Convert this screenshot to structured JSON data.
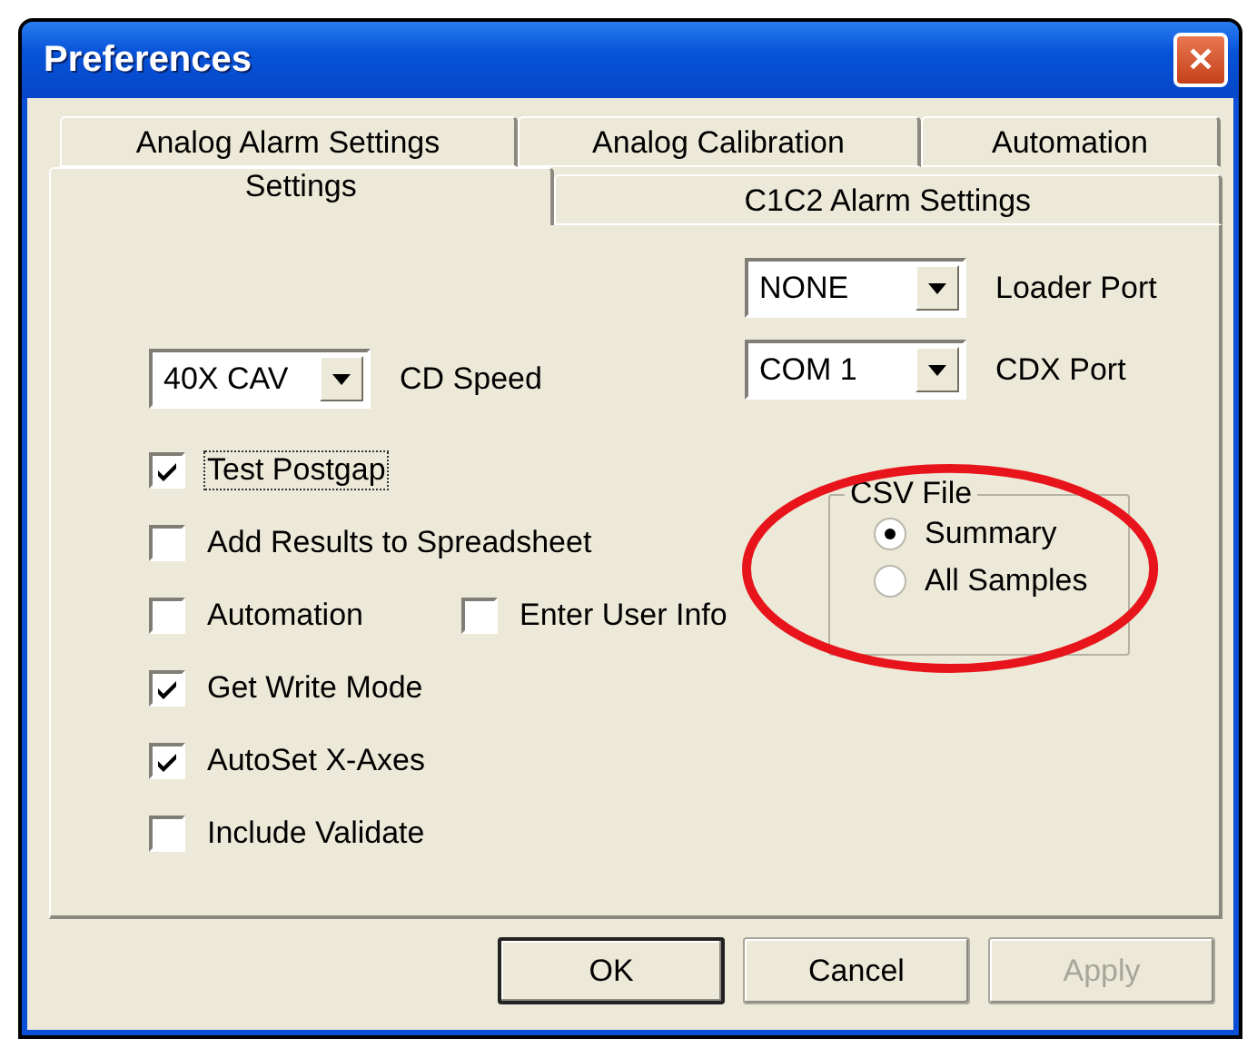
{
  "window": {
    "title": "Preferences",
    "close": "✕"
  },
  "tab_rows": [
    [
      {
        "label": "Analog Alarm Settings",
        "selected": false
      },
      {
        "label": "Analog Calibration",
        "selected": false
      },
      {
        "label": "Automation",
        "selected": false
      }
    ],
    [
      {
        "label": "Settings",
        "selected": true
      },
      {
        "label": "C1C2 Alarm Settings",
        "selected": false
      }
    ]
  ],
  "ports": [
    {
      "value": "NONE",
      "label": "Loader Port"
    },
    {
      "value": "COM 1",
      "label": "CDX Port"
    }
  ],
  "cd_speed": {
    "value": "40X CAV",
    "label": "CD Speed"
  },
  "checkbox_rows": [
    [
      {
        "label": "Test Postgap",
        "checked": true,
        "focused": true
      }
    ],
    [
      {
        "label": "Add Results to Spreadsheet",
        "checked": false,
        "focused": false
      }
    ],
    [
      {
        "label": "Automation",
        "checked": false,
        "focused": false
      },
      {
        "label": "Enter User Info",
        "checked": false,
        "focused": false
      }
    ],
    [
      {
        "label": "Get Write Mode",
        "checked": true,
        "focused": false
      }
    ],
    [
      {
        "label": "AutoSet X-Axes",
        "checked": true,
        "focused": false
      }
    ],
    [
      {
        "label": "Include Validate",
        "checked": false,
        "focused": false
      }
    ]
  ],
  "csv_file": {
    "title": "CSV File",
    "options": [
      {
        "label": "Summary",
        "selected": true
      },
      {
        "label": "All Samples",
        "selected": false
      }
    ]
  },
  "annotation": {
    "kind": "ellipse",
    "color": "#e8141b"
  },
  "buttons": [
    {
      "label": "OK",
      "default": true,
      "disabled": false
    },
    {
      "label": "Cancel",
      "default": false,
      "disabled": false
    },
    {
      "label": "Apply",
      "default": false,
      "disabled": true
    }
  ]
}
